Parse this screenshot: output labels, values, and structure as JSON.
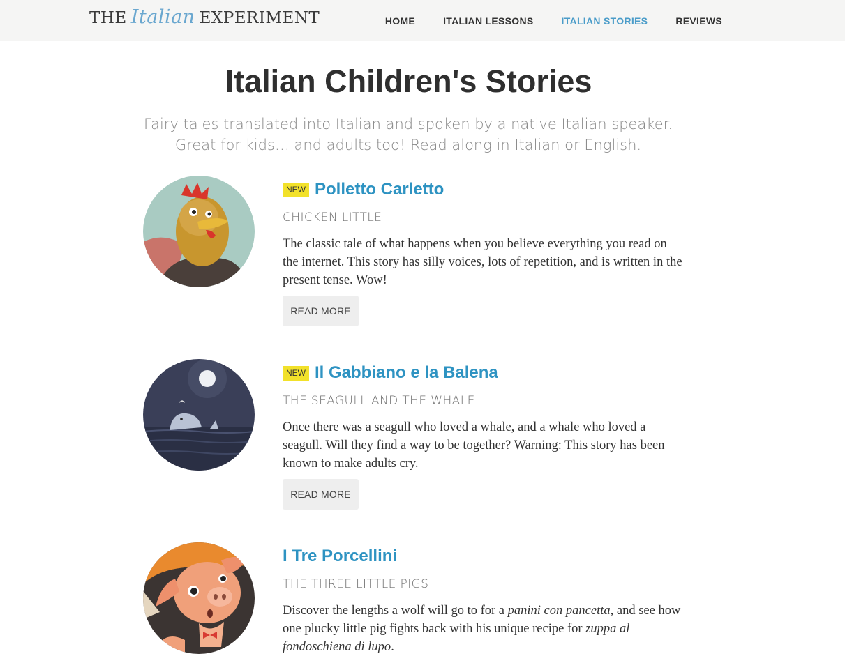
{
  "header": {
    "logo": {
      "the": "THE",
      "italian": "Italian",
      "experiment": "EXPERIMENT"
    },
    "nav": [
      {
        "label": "HOME"
      },
      {
        "label": "ITALIAN LESSONS"
      },
      {
        "label": "ITALIAN STORIES",
        "active": true
      },
      {
        "label": "REVIEWS"
      }
    ]
  },
  "main": {
    "title": "Italian Children's Stories",
    "subtitle": "Fairy tales translated into Italian and spoken by a native Italian speaker. Great for kids… and adults too! Read along in Italian or English.",
    "stories": [
      {
        "badge": "NEW",
        "title": "Polletto Carletto",
        "subtitle": "CHICKEN LITTLE",
        "description": "The classic tale of what happens when you believe everything you read on the internet. This story has silly voices, lots of repetition, and is written in the present tense. Wow!",
        "button": "READ MORE",
        "image_icon": "chicken-illustration"
      },
      {
        "badge": "NEW",
        "title": "Il Gabbiano e la Balena",
        "subtitle": "THE SEAGULL AND THE WHALE",
        "description": "Once there was a seagull who loved a whale, and a whale who loved a seagull. Will they find a way to be together? Warning: This story has been known to make adults cry.",
        "button": "READ MORE",
        "image_icon": "whale-moon-illustration"
      },
      {
        "title": "I Tre Porcellini",
        "subtitle": "THE THREE LITTLE PIGS",
        "description_parts": [
          "Discover the lengths a wolf will go to for a ",
          "panini con pancetta",
          ", and see how one plucky little pig fights back with his unique recipe for ",
          "zuppa al fondoschiena di lupo",
          "."
        ],
        "image_icon": "pig-illustration"
      }
    ]
  },
  "colors": {
    "header_bg": "#f5f5f4",
    "nav_active": "#4a9cc9",
    "story_title": "#2e93c2",
    "badge": "#f2e12a",
    "button_bg": "#eeeeee"
  }
}
